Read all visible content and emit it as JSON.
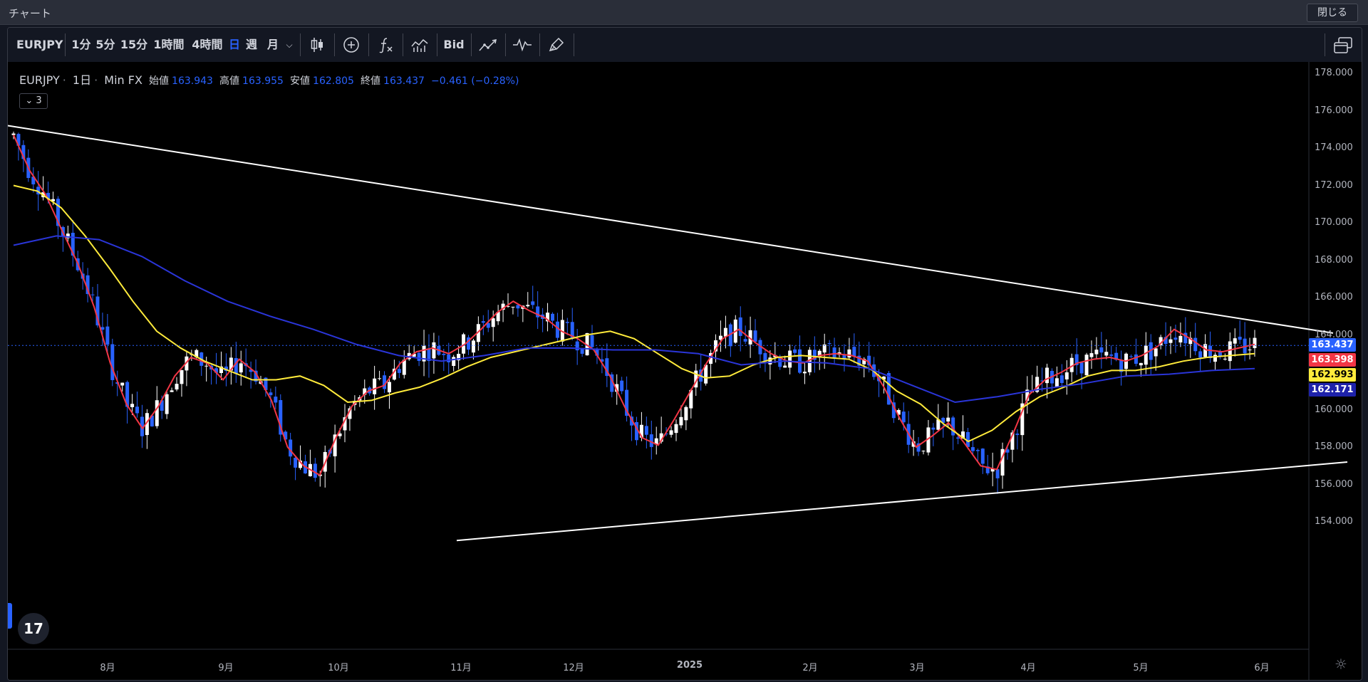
{
  "window": {
    "title": "チャート",
    "close_label": "閉じる"
  },
  "toolbar": {
    "symbol": "EURJPY",
    "timeframes": [
      "1分",
      "5分",
      "15分",
      "1時間",
      "4時間",
      "日",
      "週",
      "月"
    ],
    "active_timeframe": "日",
    "bid_label": "Bid",
    "icons": [
      "candlestick-icon",
      "add-indicator-icon",
      "formula-icon",
      "bar-style-icon",
      "trend-icon",
      "waveform-icon",
      "brush-icon",
      "window-layout-icon"
    ]
  },
  "legend": {
    "symbol": "EURJPY",
    "interval": "1日",
    "source": "Min FX",
    "open_label": "始値",
    "open": "163.943",
    "high_label": "高値",
    "high": "163.955",
    "low_label": "安値",
    "low": "162.805",
    "close_label": "終値",
    "close": "163.437",
    "change": "−0.461 (−0.28%)",
    "collapse_count": "3"
  },
  "price_labels": [
    {
      "value": "163.437",
      "color": "#2962ff"
    },
    {
      "value": "163.398",
      "color": "#f23645"
    },
    {
      "value": "162.993",
      "color": "#ffeb3b"
    },
    {
      "value": "162.171",
      "color": "#1e22aa"
    }
  ],
  "chart_data": {
    "type": "line",
    "symbol": "EURJPY",
    "yticks": [
      "178.000",
      "176.000",
      "174.000",
      "172.000",
      "170.000",
      "168.000",
      "166.000",
      "164.000",
      "160.000",
      "158.000",
      "156.000",
      "154.000"
    ],
    "xticks": [
      "8月",
      "9月",
      "10月",
      "11月",
      "12月",
      "2025",
      "2月",
      "3月",
      "4月",
      "5月",
      "6月"
    ],
    "ylim": [
      153.5,
      178
    ],
    "grid": false,
    "series": [
      {
        "values": [
          174.7,
          172.8,
          171.5,
          169.6,
          167.8,
          165.5,
          162.5,
          160.3,
          159.0,
          160.2,
          161.8,
          162.8,
          162.5,
          161.6,
          162.7,
          162.0,
          160.5,
          158.0,
          157.0,
          156.5,
          158.5,
          160.2,
          161.0,
          161.3,
          162.5,
          163.1,
          163.3,
          163.0,
          163.5,
          164.3,
          165.2,
          165.8,
          165.3,
          164.9,
          164.2,
          163.8,
          163.2,
          161.8,
          160.0,
          158.5,
          158.1,
          159.5,
          161.0,
          162.5,
          163.8,
          164.3,
          163.6,
          163.0,
          162.6,
          162.5,
          162.9,
          163.0,
          162.9,
          162.6,
          161.2,
          159.5,
          158.0,
          158.6,
          159.3,
          158.2,
          157.0,
          156.8,
          158.7,
          160.8,
          161.6,
          162.0,
          162.5,
          162.7,
          162.8,
          162.6,
          162.9,
          163.4,
          164.3,
          163.8,
          163.2,
          163.1,
          163.3,
          163.5
        ]
      },
      {
        "values": [
          172.0,
          171.7,
          170.8,
          169.3,
          167.6,
          165.8,
          164.2,
          163.3,
          162.6,
          162.1,
          161.6,
          161.6,
          161.8,
          161.3,
          160.4,
          160.5,
          160.9,
          161.2,
          161.7,
          162.3,
          162.8,
          163.1,
          163.4,
          163.7,
          164.0,
          164.2,
          163.8,
          163.0,
          162.2,
          161.7,
          161.8,
          162.4,
          162.8,
          162.9,
          162.8,
          162.7,
          162.1,
          161.0,
          160.3,
          159.2,
          158.3,
          158.9,
          159.9,
          160.7,
          161.2,
          161.8,
          162.1,
          162.1,
          162.3,
          162.6,
          162.8,
          162.9,
          163.0
        ]
      },
      {
        "values": [
          168.8,
          169.3,
          169.1,
          168.2,
          166.9,
          165.8,
          165.0,
          164.3,
          163.5,
          162.9,
          162.6,
          162.9,
          163.3,
          163.3,
          163.2,
          163.2,
          163.0,
          162.4,
          162.6,
          162.5,
          162.2,
          161.3,
          160.4,
          160.7,
          161.1,
          161.4,
          161.8,
          161.9,
          162.1,
          162.2
        ]
      }
    ],
    "trendlines": [
      {
        "points": [
          [
            0,
            175.2
          ],
          [
            1860,
            164.1
          ]
        ]
      },
      {
        "points": [
          [
            630,
            153.0
          ],
          [
            1880,
            157.2
          ]
        ]
      }
    ]
  }
}
